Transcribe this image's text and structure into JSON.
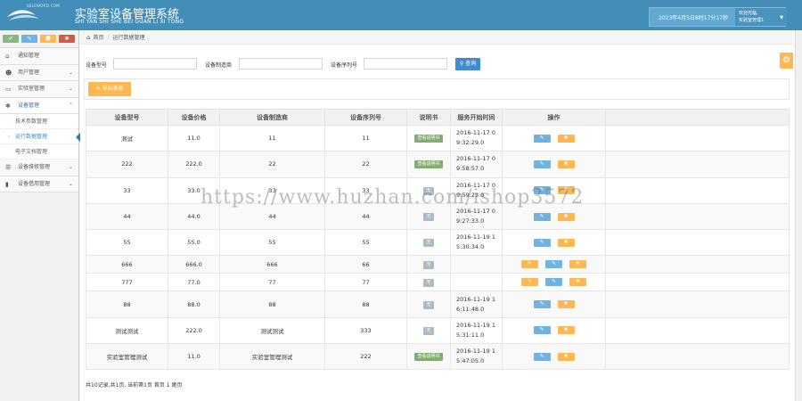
{
  "header": {
    "logo_small_text": "SELEWORD.COM",
    "title": "实验室设备管理系统",
    "pinyin": "SHI YAN SHI SHE BEI GUAN LI XI TONG",
    "datetime": "2023年4月5日8时17分17秒",
    "welcome": "欢迎光临,",
    "user": "实验室管理1"
  },
  "sidebar": {
    "shortcuts": [
      {
        "icon": "chart-icon",
        "glyph": "✔",
        "color": "#87b87f"
      },
      {
        "icon": "pencil-icon",
        "glyph": "✎",
        "color": "#6fb3e0"
      },
      {
        "icon": "users-icon",
        "glyph": "☻",
        "color": "#ffb752"
      },
      {
        "icon": "cogs-icon",
        "glyph": "✱",
        "color": "#d15b47"
      }
    ],
    "items": [
      {
        "label": "通知管理",
        "icon": "home-icon",
        "glyph": "⌂"
      },
      {
        "label": "用户管理",
        "icon": "users-icon",
        "glyph": "☻"
      },
      {
        "label": "实验室管理",
        "icon": "desktop-icon",
        "glyph": "▭"
      },
      {
        "label": "设备管理",
        "icon": "cogs-icon",
        "glyph": "✱"
      },
      {
        "label": "设备维修管理",
        "icon": "list-icon",
        "glyph": "☰"
      },
      {
        "label": "设备借用管理",
        "icon": "bookmark-icon",
        "glyph": "▮"
      }
    ],
    "sub_items": [
      "技术参数管理",
      "运行数据管理",
      "电子文档管理"
    ]
  },
  "breadcrumb": {
    "home": "首页",
    "current": "运行数据管理"
  },
  "search": {
    "model_label": "设备型号",
    "maker_label": "设备制造商",
    "serial_label": "设备序列号",
    "button": "查询"
  },
  "toolbar": {
    "export": "+ 导出表格"
  },
  "table": {
    "headers": [
      "设备型号",
      "设备价格",
      "设备制造商",
      "设备序列号",
      "说明书",
      "服务开始时间",
      "操作"
    ],
    "rows": [
      {
        "model": "测试",
        "price": "11.0",
        "maker": "11",
        "serial": "11",
        "manual": "查看说明书",
        "time1": "2016-11-17 0",
        "time2": "9:32:29.0"
      },
      {
        "model": "222",
        "price": "222.0",
        "maker": "22",
        "serial": "22",
        "manual": "查看说明书",
        "time1": "2016-11-17 0",
        "time2": "9:58:57.0"
      },
      {
        "model": "33",
        "price": "33.0",
        "maker": "33",
        "serial": "33",
        "manual": "无",
        "time1": "2016-11-17 0",
        "time2": "9:59:23.0"
      },
      {
        "model": "44",
        "price": "44.0",
        "maker": "44",
        "serial": "44",
        "manual": "无",
        "time1": "2016-11-17 0",
        "time2": "9:27:33.0"
      },
      {
        "model": "55",
        "price": "55.0",
        "maker": "55",
        "serial": "55",
        "manual": "无",
        "time1": "2016-11-19 1",
        "time2": "5:30:34.0"
      },
      {
        "model": "666",
        "price": "666.0",
        "maker": "666",
        "serial": "66",
        "manual": "无",
        "time1": "",
        "time2": ""
      },
      {
        "model": "777",
        "price": "77.0",
        "maker": "77",
        "serial": "77",
        "manual": "无",
        "time1": "",
        "time2": ""
      },
      {
        "model": "88",
        "price": "88.0",
        "maker": "88",
        "serial": "88",
        "manual": "无",
        "time1": "2016-11-19 1",
        "time2": "6:11:48.0"
      },
      {
        "model": "测试测试",
        "price": "222.0",
        "maker": "测试测试",
        "serial": "333",
        "manual": "无",
        "time1": "2016-11-19 1",
        "time2": "5:31:11.0"
      },
      {
        "model": "实验室管理测试",
        "price": "11.0",
        "maker": "实验室管理测试",
        "serial": "222",
        "manual": "查看说明书",
        "time1": "2016-11-19 1",
        "time2": "5:47:05.0"
      }
    ]
  },
  "pager": {
    "text": "共10记录,共1页, 当前第1页 首页 1 尾页"
  },
  "watermark": "https://www.huzhan.com/ishop3572",
  "colors": {
    "header": "#438eb9",
    "accent_blue": "#6fb3e0",
    "accent_orange": "#ffb752",
    "badge_green": "#82af6f"
  }
}
